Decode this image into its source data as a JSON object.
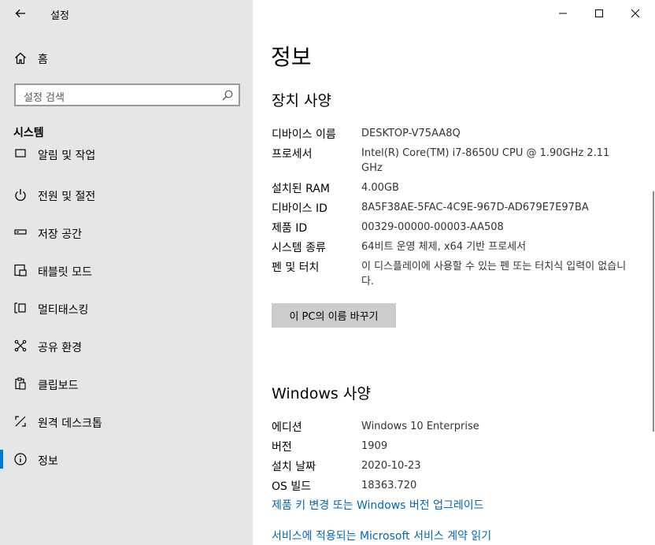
{
  "app_title": "설정",
  "home": {
    "label": "홈"
  },
  "search": {
    "placeholder": "설정 검색"
  },
  "section_title": "시스템",
  "nav_items": [
    {
      "label": "알림 및 작업",
      "icon": "notification-icon"
    },
    {
      "label": "전원 및 절전",
      "icon": "power-icon"
    },
    {
      "label": "저장 공간",
      "icon": "storage-icon"
    },
    {
      "label": "태블릿 모드",
      "icon": "tablet-icon"
    },
    {
      "label": "멀티태스킹",
      "icon": "multitasking-icon"
    },
    {
      "label": "공유 환경",
      "icon": "share-icon"
    },
    {
      "label": "클립보드",
      "icon": "clipboard-icon"
    },
    {
      "label": "원격 데스크톱",
      "icon": "remote-desktop-icon"
    },
    {
      "label": "정보",
      "icon": "info-icon",
      "active": true
    }
  ],
  "page_title": "정보",
  "device_specs": {
    "title": "장치 사양",
    "rows": [
      {
        "key": "디바이스 이름",
        "value": "DESKTOP-V75AA8Q"
      },
      {
        "key": "프로세서",
        "value": "Intel(R) Core(TM) i7-8650U CPU @ 1.90GHz   2.11 GHz"
      },
      {
        "key": "설치된 RAM",
        "value": "4.00GB"
      },
      {
        "key": "디바이스 ID",
        "value": "8A5F38AE-5FAC-4C9E-967D-AD679E7E97BA"
      },
      {
        "key": "제품 ID",
        "value": "00329-00000-00003-AA508"
      },
      {
        "key": "시스템 종류",
        "value": "64비트 운영 체제, x64 기반 프로세서"
      },
      {
        "key": "펜 및 터치",
        "value": "이 디스플레이에 사용할 수 있는 펜 또는 터치식 입력이 없습니다."
      }
    ],
    "rename_button": "이 PC의 이름 바꾸기"
  },
  "windows_specs": {
    "title": "Windows 사양",
    "rows": [
      {
        "key": "에디션",
        "value": "Windows 10 Enterprise"
      },
      {
        "key": "버전",
        "value": "1909"
      },
      {
        "key": "설치 날짜",
        "value": "2020-10-23"
      },
      {
        "key": "OS 빌드",
        "value": "18363.720"
      }
    ],
    "links": [
      "제품 키 변경 또는 Windows 버전 업그레이드",
      "서비스에 적용되는 Microsoft 서비스 계약 읽기"
    ]
  },
  "colors": {
    "accent": "#0078d7",
    "link": "#0067b8",
    "sidebar_bg": "#e6e6e6"
  }
}
